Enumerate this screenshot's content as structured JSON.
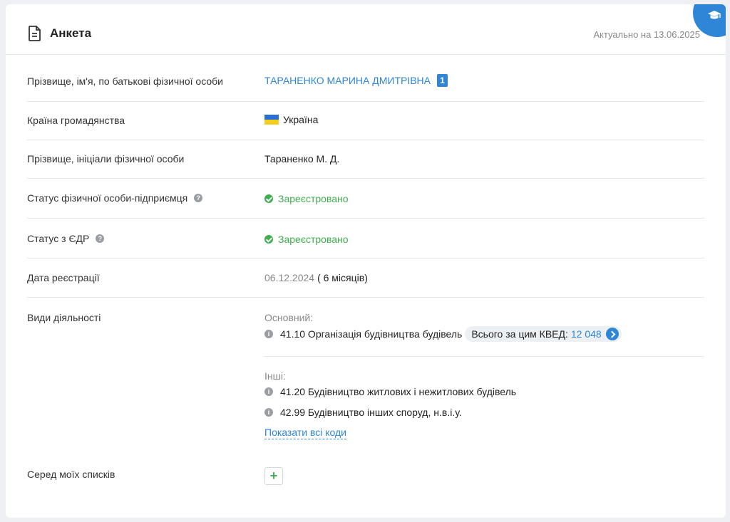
{
  "header": {
    "title": "Анкета",
    "actual_date": "Актуально на 13.06.2025"
  },
  "rows": {
    "full_name": {
      "label": "Прізвище, ім'я, по батькові фізичної особи",
      "value": "ТАРАНЕНКО МАРИНА ДМИТРІВНА",
      "badge": "1"
    },
    "citizenship": {
      "label": "Країна громадянства",
      "value": "Україна"
    },
    "initials": {
      "label": "Прізвище, ініціали фізичної особи",
      "value": "Тараненко М. Д."
    },
    "fop_status": {
      "label": "Статус фізичної особи-підприємця",
      "help": "?",
      "value": "Зареєстровано"
    },
    "edr_status": {
      "label": "Статус з ЄДР",
      "help": "?",
      "value": "Зареєстровано"
    },
    "reg_date": {
      "label": "Дата реєстрації",
      "date": "06.12.2024",
      "duration": "( 6 місяців)"
    },
    "activities": {
      "label": "Види діяльності",
      "main_label": "Основний:",
      "main_code": "41.10 Організація будівництва будівель",
      "kved_total_label": "Всього за цим КВЕД:",
      "kved_total_value": "12 048",
      "other_label": "Інші:",
      "other_codes": [
        "41.20 Будівництво житлових і нежитлових будівель",
        "42.99 Будівництво інших споруд, н.в.і.у."
      ],
      "show_all": "Показати всі коди"
    },
    "lists": {
      "label": "Серед моїх списків",
      "add": "+"
    }
  },
  "colors": {
    "accent": "#2f86d6",
    "success": "#3fae4f",
    "muted": "#888888"
  }
}
